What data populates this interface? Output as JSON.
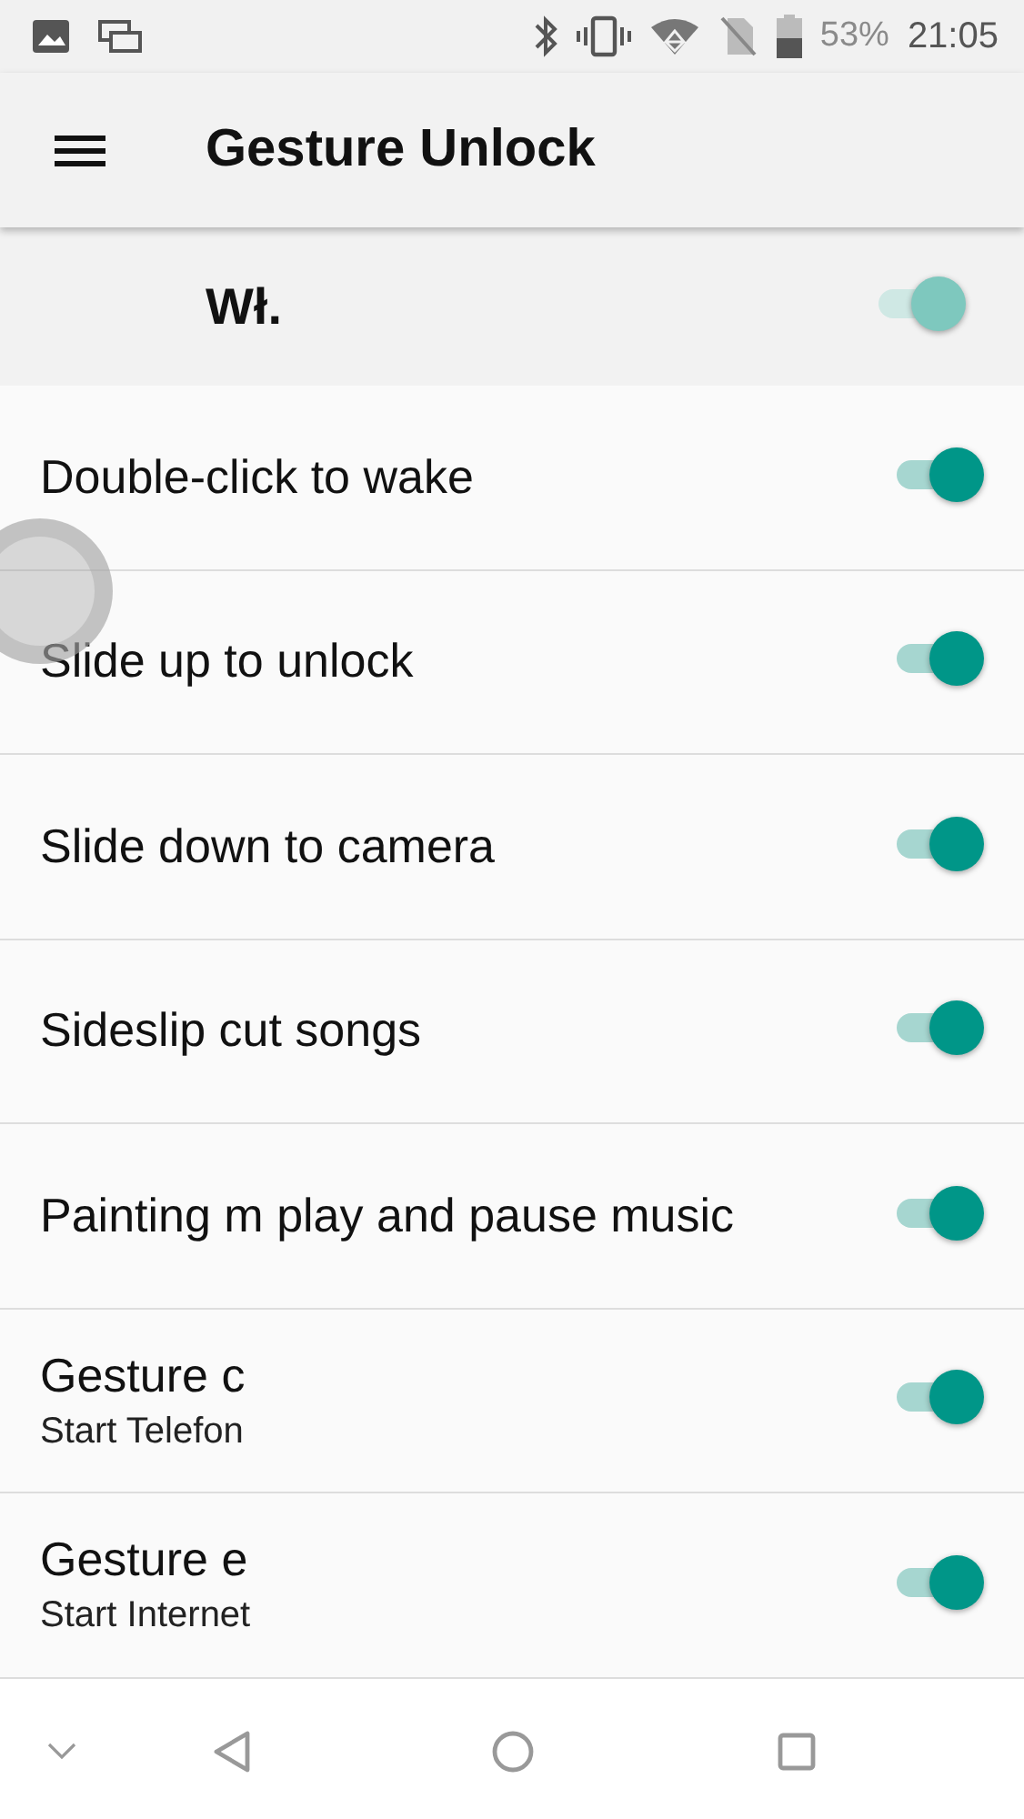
{
  "status_bar": {
    "battery": "53%",
    "time": "21:05"
  },
  "app_bar": {
    "title": "Gesture Unlock"
  },
  "master": {
    "label": "Wł.",
    "on": true
  },
  "settings": [
    {
      "title": "Double-click to wake",
      "on": true
    },
    {
      "title": "Slide up to unlock",
      "on": true
    },
    {
      "title": "Slide down to camera",
      "on": true
    },
    {
      "title": "Sideslip cut songs",
      "on": true
    },
    {
      "title": "Painting m play and pause music",
      "on": true
    },
    {
      "title": "Gesture c",
      "subtitle": "Start Telefon",
      "on": true
    },
    {
      "title": "Gesture e",
      "subtitle": "Start Internet",
      "on": true
    }
  ]
}
